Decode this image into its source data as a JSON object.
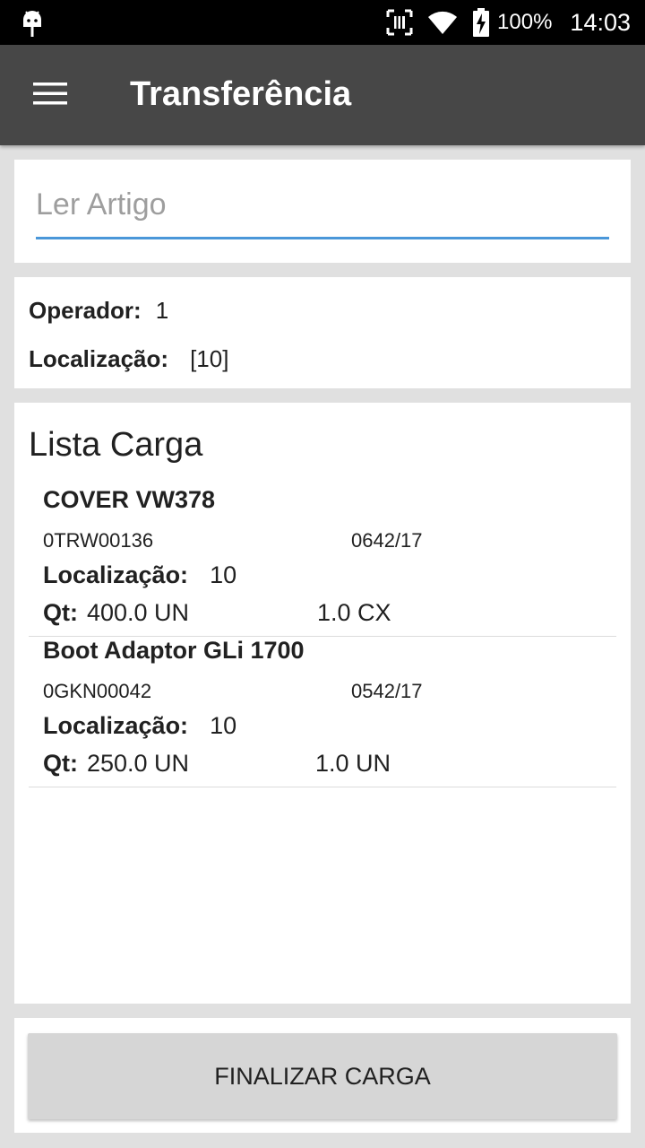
{
  "status_bar": {
    "battery": "100%",
    "time": "14:03",
    "icons": [
      "android-debug-icon",
      "nfc-icon",
      "wifi-icon",
      "battery-charging-icon"
    ]
  },
  "app_bar": {
    "title": "Transferência",
    "menu_icon": "hamburger-menu-icon"
  },
  "search": {
    "placeholder": "Ler Artigo",
    "value": ""
  },
  "info": {
    "operator_label": "Operador:",
    "operator_value": "1",
    "location_label": "Localização:",
    "location_value": "[10]"
  },
  "list": {
    "title": "Lista Carga",
    "items": [
      {
        "name": "COVER VW378",
        "code": "0TRW00136",
        "date": "0642/17",
        "location_label": "Localização:",
        "location": "10",
        "qt_label": "Qt:",
        "qt": "400.0 UN",
        "qt_secondary": "1.0 CX"
      },
      {
        "name": "Boot Adaptor GLi 1700",
        "code": "0GKN00042",
        "date": "0542/17",
        "location_label": "Localização:",
        "location": "10",
        "qt_label": "Qt:",
        "qt": "250.0 UN",
        "qt_secondary": "1.0 UN"
      }
    ]
  },
  "footer": {
    "finish_label": "FINALIZAR CARGA"
  },
  "colors": {
    "app_bar": "#474747",
    "accent_underline": "#4a97d9",
    "background": "#e0e0e0"
  }
}
